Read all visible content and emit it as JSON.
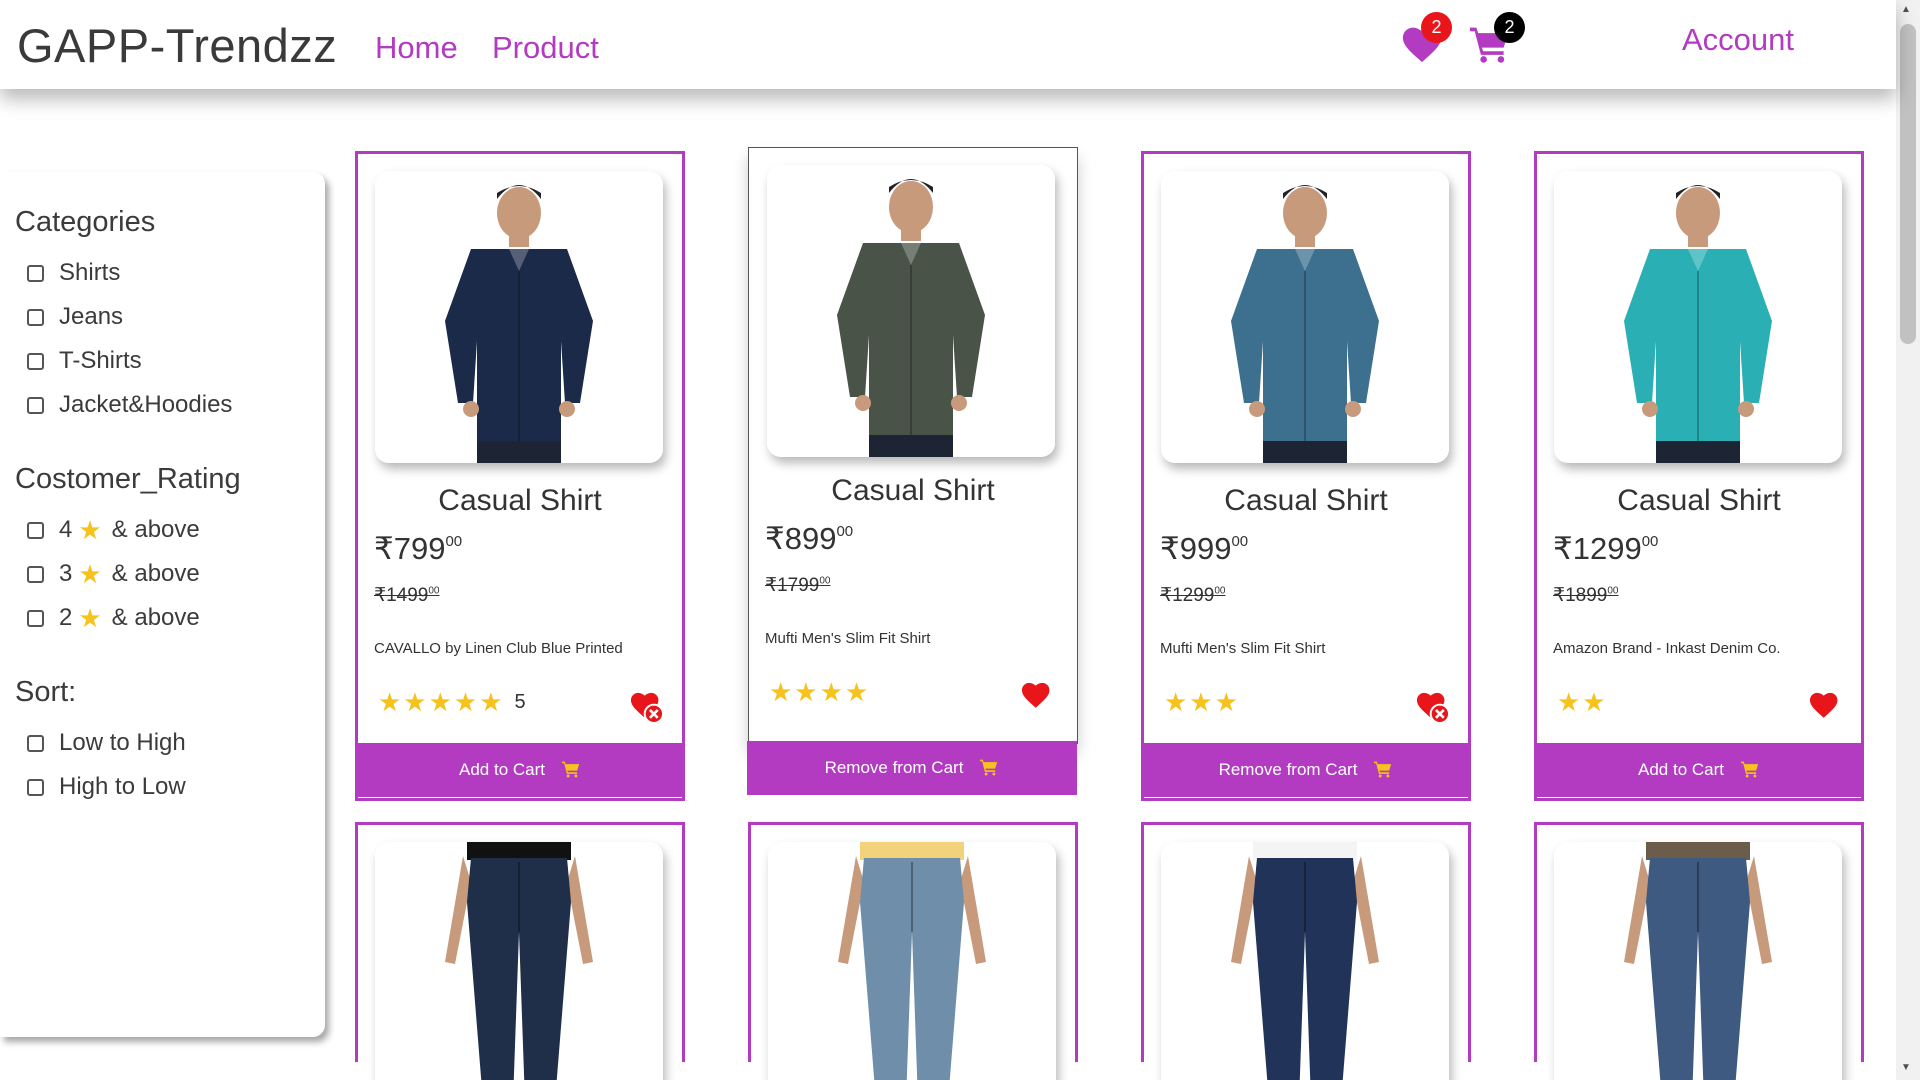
{
  "header": {
    "brand": "GAPP-Trendzz",
    "nav": [
      "Home",
      "Product"
    ],
    "wishlist_count": "2",
    "cart_count": "2",
    "account_label": "Account",
    "accent_color": "#b23bc2"
  },
  "sidebar": {
    "categories_title": "Categories",
    "categories": [
      "Shirts",
      "Jeans",
      "T-Shirts",
      "Jacket&Hoodies"
    ],
    "rating_title": "Costomer_Rating",
    "ratings": [
      {
        "value": "4",
        "suffix": "& above"
      },
      {
        "value": "3",
        "suffix": "& above"
      },
      {
        "value": "2",
        "suffix": "& above"
      }
    ],
    "sort_title": "Sort:",
    "sort_options": [
      "Low to High",
      "High to Low"
    ]
  },
  "products": [
    {
      "title": "Casual Shirt",
      "price": "₹799",
      "price_paise": "00",
      "mrp": "₹1499",
      "mrp_paise": "00",
      "desc": "CAVALLO by Linen Club Blue Printed",
      "stars": "★★★★★",
      "rating_count": "5",
      "wishlist_state": "remove",
      "button": "Add to Cart",
      "shirt_color": "#1c2a4a"
    },
    {
      "title": "Casual Shirt",
      "price": "₹899",
      "price_paise": "00",
      "mrp": "₹1799",
      "mrp_paise": "00",
      "desc": "Mufti Men's Slim Fit Shirt",
      "stars": "★★★★",
      "rating_count": "",
      "wishlist_state": "added",
      "button": "Remove from Cart",
      "shirt_color": "#4a5347"
    },
    {
      "title": "Casual Shirt",
      "price": "₹999",
      "price_paise": "00",
      "mrp": "₹1299",
      "mrp_paise": "00",
      "desc": "Mufti Men's Slim Fit Shirt",
      "stars": "★★★",
      "rating_count": "",
      "wishlist_state": "remove",
      "button": "Remove from Cart",
      "shirt_color": "#3d6f8e"
    },
    {
      "title": "Casual Shirt",
      "price": "₹1299",
      "price_paise": "00",
      "mrp": "₹1899",
      "mrp_paise": "00",
      "desc": "Amazon Brand - Inkast Denim Co.",
      "stars": "★★",
      "rating_count": "",
      "wishlist_state": "added",
      "button": "Add to Cart",
      "shirt_color": "#2ab0b4"
    }
  ],
  "jeans": [
    {
      "color": "#1f2f4a",
      "top": "#111111"
    },
    {
      "color": "#6e8eaa",
      "top": "#f2d27a"
    },
    {
      "color": "#22335a",
      "top": "#f4f4f4"
    },
    {
      "color": "#3e5a80",
      "top": "#6b5c4c"
    }
  ]
}
